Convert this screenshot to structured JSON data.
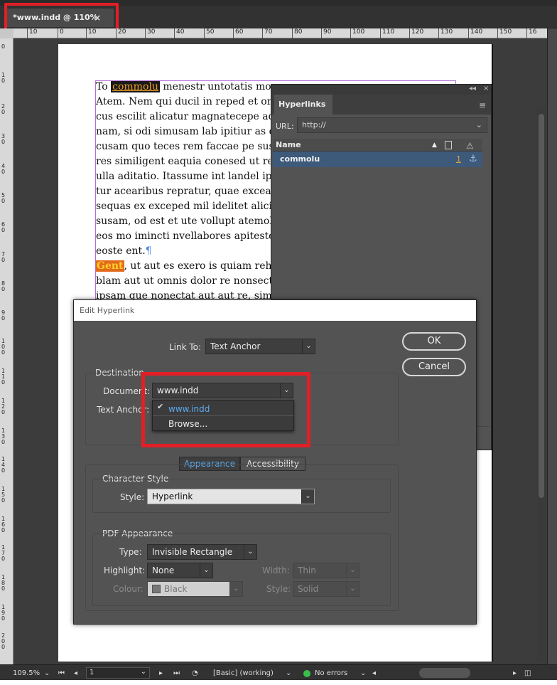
{
  "document_tab": {
    "title": "*www.indd @ 110%",
    "close": "×"
  },
  "ruler": {
    "horizontal": [
      "10",
      "0",
      "10",
      "20",
      "30",
      "40",
      "50",
      "60",
      "70",
      "80",
      "90",
      "100",
      "110",
      "120",
      "130",
      "140",
      "150",
      "16"
    ],
    "vertical": [
      "0",
      "10",
      "20",
      "30",
      "40",
      "50",
      "60",
      "70",
      "80",
      "90",
      "100",
      "110",
      "120",
      "130",
      "140",
      "150",
      "160",
      "170",
      "180",
      "190",
      "200"
    ]
  },
  "body_text": {
    "line1_pre": "To ",
    "line1_link": "commolu",
    "line1_post": " menestr untotatis mo",
    "lines": [
      "Atem. Nem qui ducil in reped et om",
      "cus escilit alicatur magnatecepe adis",
      "nam, si odi simusam lab ipitiur as d",
      "cusam quo teces rem faccae pe susam",
      "res similigent eaquia conesed ut re s",
      "ulla aditatio. Itassume int landel ips",
      "tur acearibus repratur, quae excea ip",
      "sequas ex exceped mil idelitet alicit",
      "susam, od est et ute vollupt atemolo",
      "eos mo imincti nvellabores apitester"
    ],
    "para_end": "eoste ent.",
    "pilcrow": "¶",
    "gent": "Gent",
    "gent_post": ", ut aut es exero is quiam reher",
    "line_after_1": "blam aut ut omnis dolor re nonsectu",
    "line_after_2": "ipsam que nonectat aut aut re, sim a"
  },
  "hyperlinks_panel": {
    "collapse": "◂◂",
    "close": "×",
    "tab": "Hyperlinks",
    "menu": "≡",
    "url_label": "URL:",
    "url_value": "http://",
    "column_name": "Name",
    "sort": "▲",
    "warning": "⚠",
    "row_name": "commolu",
    "row_page": "1",
    "row_anchor": "⚓"
  },
  "dialog": {
    "title": "Edit Hyperlink",
    "link_to_label": "Link To:",
    "link_to_value": "Text Anchor",
    "ok": "OK",
    "cancel": "Cancel",
    "destination_label": "Destination",
    "document_label": "Document:",
    "document_value": "www.indd",
    "text_anchor_label": "Text Anchor:",
    "document_menu": {
      "checked": "www.indd",
      "browse": "Browse..."
    },
    "tabs": [
      "Appearance",
      "Accessibility"
    ],
    "character_style_label": "Character Style",
    "style_label": "Style:",
    "style_value": "Hyperlink",
    "pdf_appearance_label": "PDF Appearance",
    "type_label": "Type:",
    "type_value": "Invisible Rectangle",
    "highlight_label": "Highlight:",
    "highlight_value": "None",
    "width_label": "Width:",
    "width_value": "Thin",
    "colour_label": "Colour:",
    "colour_value": "Black",
    "style2_label": "Style:",
    "style2_value": "Solid"
  },
  "status_bar": {
    "zoom": "109.5%",
    "page": "1",
    "preflight_profile": "[Basic] (working)",
    "errors": "No errors"
  },
  "colors": {
    "highlight_box": "#e21f26",
    "accent_blue": "#5aaaf0",
    "ok_dot": "#3ac04a"
  }
}
